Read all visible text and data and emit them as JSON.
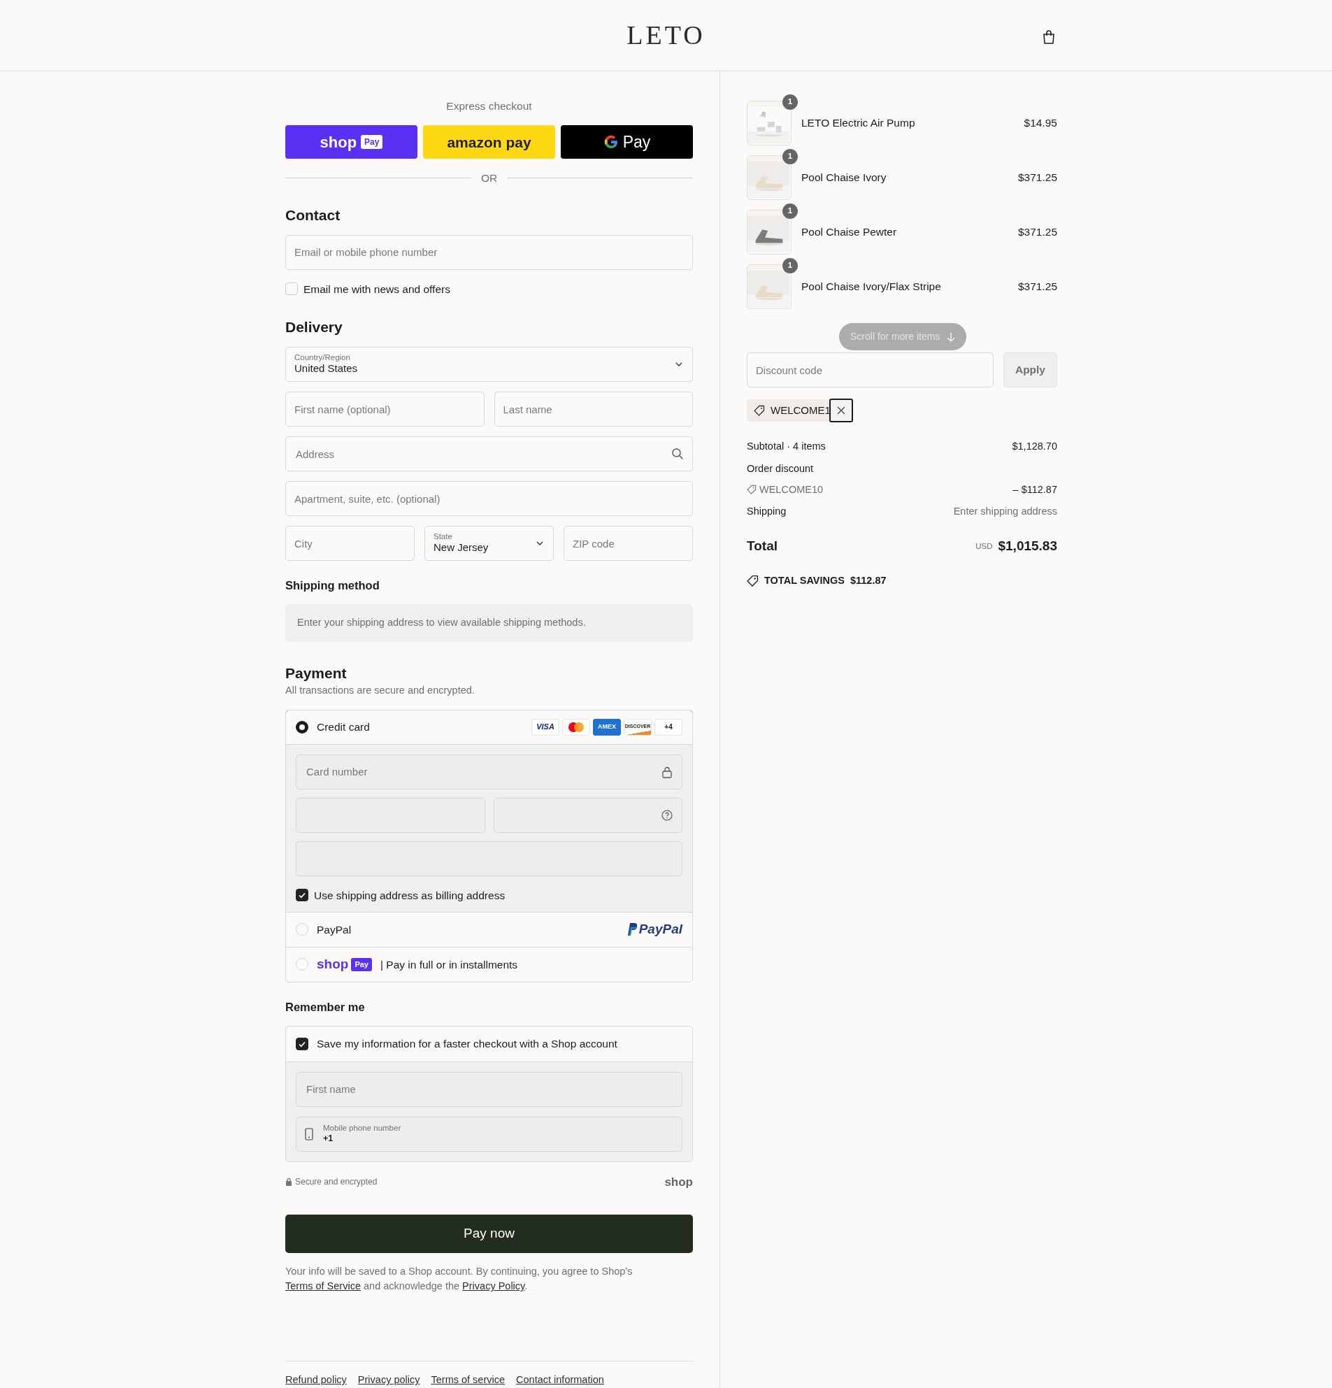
{
  "header": {
    "logo": "LETO"
  },
  "express": {
    "title": "Express checkout",
    "buttons": [
      {
        "kind": "shop",
        "label": "shop",
        "badge": "Pay"
      },
      {
        "kind": "amazon",
        "label": "amazon pay"
      },
      {
        "kind": "google",
        "label": "Pay"
      }
    ],
    "divider": "OR"
  },
  "contact": {
    "title": "Contact",
    "email": {
      "placeholder": "Email or mobile phone number"
    },
    "newsletter": {
      "label": "Email me with news and offers",
      "checked": false
    }
  },
  "delivery": {
    "title": "Delivery",
    "country": {
      "label": "Country/Region",
      "value": "United States"
    },
    "first_name": {
      "placeholder": "First name (optional)"
    },
    "last_name": {
      "placeholder": "Last name"
    },
    "address": {
      "placeholder": "Address"
    },
    "apartment": {
      "placeholder": "Apartment, suite, etc. (optional)"
    },
    "city": {
      "placeholder": "City"
    },
    "state": {
      "label": "State",
      "value": "New Jersey"
    },
    "zip": {
      "placeholder": "ZIP code"
    }
  },
  "shipping_method": {
    "title": "Shipping method",
    "notice": "Enter your shipping address to view available shipping methods."
  },
  "payment": {
    "title": "Payment",
    "subtitle": "All transactions are secure and encrypted.",
    "methods": [
      {
        "kind": "card",
        "label": "Credit card",
        "selected": true
      },
      {
        "kind": "paypal",
        "label": "PayPal",
        "logo": "PayPal",
        "selected": false
      },
      {
        "kind": "shop",
        "logo": "shop",
        "badge": "Pay",
        "label": "| Pay in full or in installments",
        "selected": false
      }
    ],
    "card_brands": [
      {
        "kind": "visa",
        "label": "VISA"
      },
      {
        "kind": "mastercard"
      },
      {
        "kind": "amex",
        "label": "AMEX"
      },
      {
        "kind": "discover",
        "label": "DISCOVER"
      }
    ],
    "more_cards": "+4",
    "card_number": {
      "placeholder": "Card number"
    },
    "billing_same": {
      "label": "Use shipping address as billing address",
      "checked": true
    }
  },
  "remember": {
    "title": "Remember me",
    "save": {
      "label": "Save my information for a faster checkout with a Shop account",
      "checked": true
    },
    "first_name": {
      "placeholder": "First name"
    },
    "phone": {
      "label": "Mobile phone number",
      "value": "+1"
    },
    "secure": "Secure and encrypted",
    "brand": "shop"
  },
  "pay_button": "Pay now",
  "legal": [
    {
      "kind": "text",
      "text": "Your info will be saved to a Shop account. By continuing, you agree to Shop’s "
    },
    {
      "kind": "link",
      "text": "Terms of Service"
    },
    {
      "kind": "text",
      "text": " and acknowledge the "
    },
    {
      "kind": "link",
      "text": "Privacy Policy"
    },
    {
      "kind": "text",
      "text": "."
    }
  ],
  "footer_links": [
    "Refund policy",
    "Privacy policy",
    "Terms of service",
    "Contact information"
  ],
  "summary": {
    "items": [
      {
        "name": "LETO Electric Air Pump",
        "quantity": "1",
        "price": "$14.95",
        "kind": "picture"
      },
      {
        "name": "Pool Chaise Ivory",
        "quantity": "1",
        "price": "$371.25",
        "kind": "picture"
      },
      {
        "name": "Pool Chaise Pewter",
        "quantity": "1",
        "price": "$371.25",
        "kind": "picture"
      },
      {
        "name": "Pool Chaise Ivory/Flax Stripe",
        "quantity": "1",
        "price": "$371.25",
        "kind": "picture"
      }
    ],
    "scroll_hint": "Scroll for more items",
    "discount": {
      "placeholder": "Discount code",
      "button": "Apply"
    },
    "applied_code": "WELCOME1",
    "subtotal": {
      "label": "Subtotal · 4 items",
      "value": "$1,128.70"
    },
    "order_discount": {
      "label": "Order discount",
      "code": "WELCOME10",
      "value": "– $112.87"
    },
    "shipping": {
      "label": "Shipping",
      "value": "Enter shipping address"
    },
    "total": {
      "label": "Total",
      "currency": "USD",
      "value": "$1,015.83"
    },
    "savings": {
      "label": "TOTAL SAVINGS",
      "value": "$112.87"
    }
  }
}
